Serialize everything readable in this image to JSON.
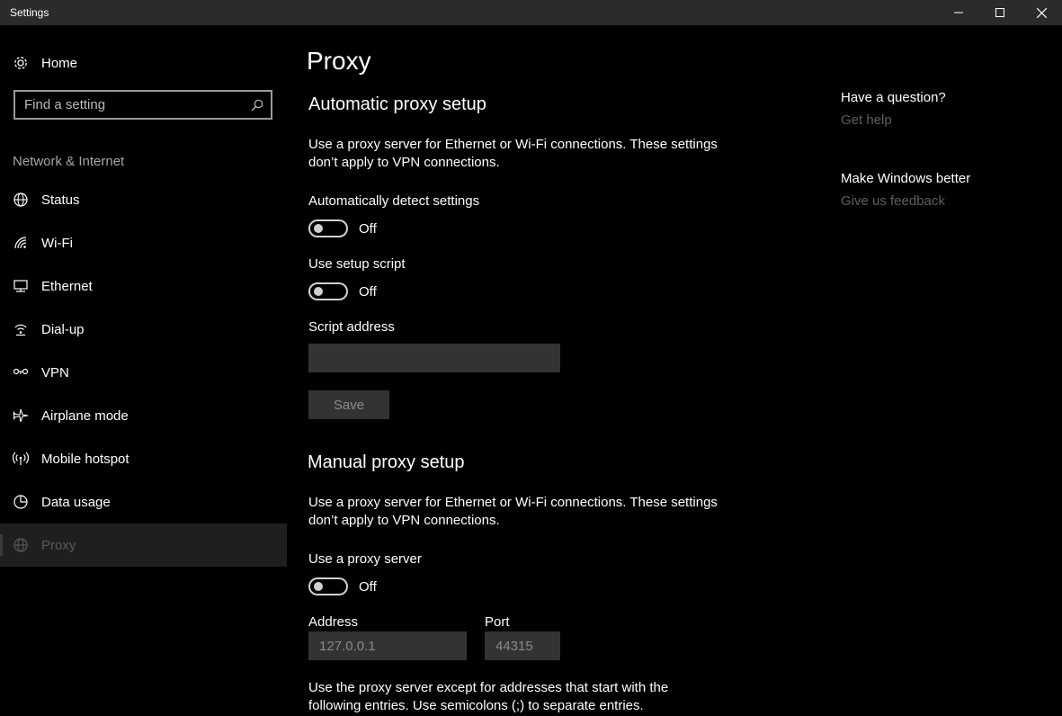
{
  "window": {
    "title": "Settings",
    "minimize_icon": "minimize-icon",
    "maximize_icon": "maximize-icon",
    "close_icon": "close-icon"
  },
  "sidebar": {
    "home_label": "Home",
    "search": {
      "placeholder": "Find a setting"
    },
    "section_label": "Network & Internet",
    "items": [
      {
        "label": "Status",
        "icon": "globe-status-icon",
        "selected": false
      },
      {
        "label": "Wi-Fi",
        "icon": "wifi-icon",
        "selected": false
      },
      {
        "label": "Ethernet",
        "icon": "ethernet-icon",
        "selected": false
      },
      {
        "label": "Dial-up",
        "icon": "dialup-icon",
        "selected": false
      },
      {
        "label": "VPN",
        "icon": "vpn-icon",
        "selected": false
      },
      {
        "label": "Airplane mode",
        "icon": "airplane-icon",
        "selected": false
      },
      {
        "label": "Mobile hotspot",
        "icon": "hotspot-icon",
        "selected": false
      },
      {
        "label": "Data usage",
        "icon": "data-usage-icon",
        "selected": false
      },
      {
        "label": "Proxy",
        "icon": "globe-icon",
        "selected": true
      }
    ]
  },
  "main": {
    "title": "Proxy",
    "automatic": {
      "heading": "Automatic proxy setup",
      "description": "Use a proxy server for Ethernet or Wi-Fi connections. These settings don’t apply to VPN connections.",
      "detect_label": "Automatically detect settings",
      "detect_state": "Off",
      "script_label": "Use setup script",
      "script_state": "Off",
      "address_label": "Script address",
      "address_value": "",
      "save_label": "Save"
    },
    "manual": {
      "heading": "Manual proxy setup",
      "description": "Use a proxy server for Ethernet or Wi-Fi connections. These settings don’t apply to VPN connections.",
      "use_proxy_label": "Use a proxy server",
      "use_proxy_state": "Off",
      "address_label": "Address",
      "address_value": "127.0.0.1",
      "port_label": "Port",
      "port_value": "44315",
      "exceptions_text": "Use the proxy server except for addresses that start with the following entries. Use semicolons (;) to separate entries."
    }
  },
  "aside": {
    "question_title": "Have a question?",
    "get_help": "Get help",
    "better_title": "Make Windows better",
    "feedback": "Give us feedback"
  }
}
